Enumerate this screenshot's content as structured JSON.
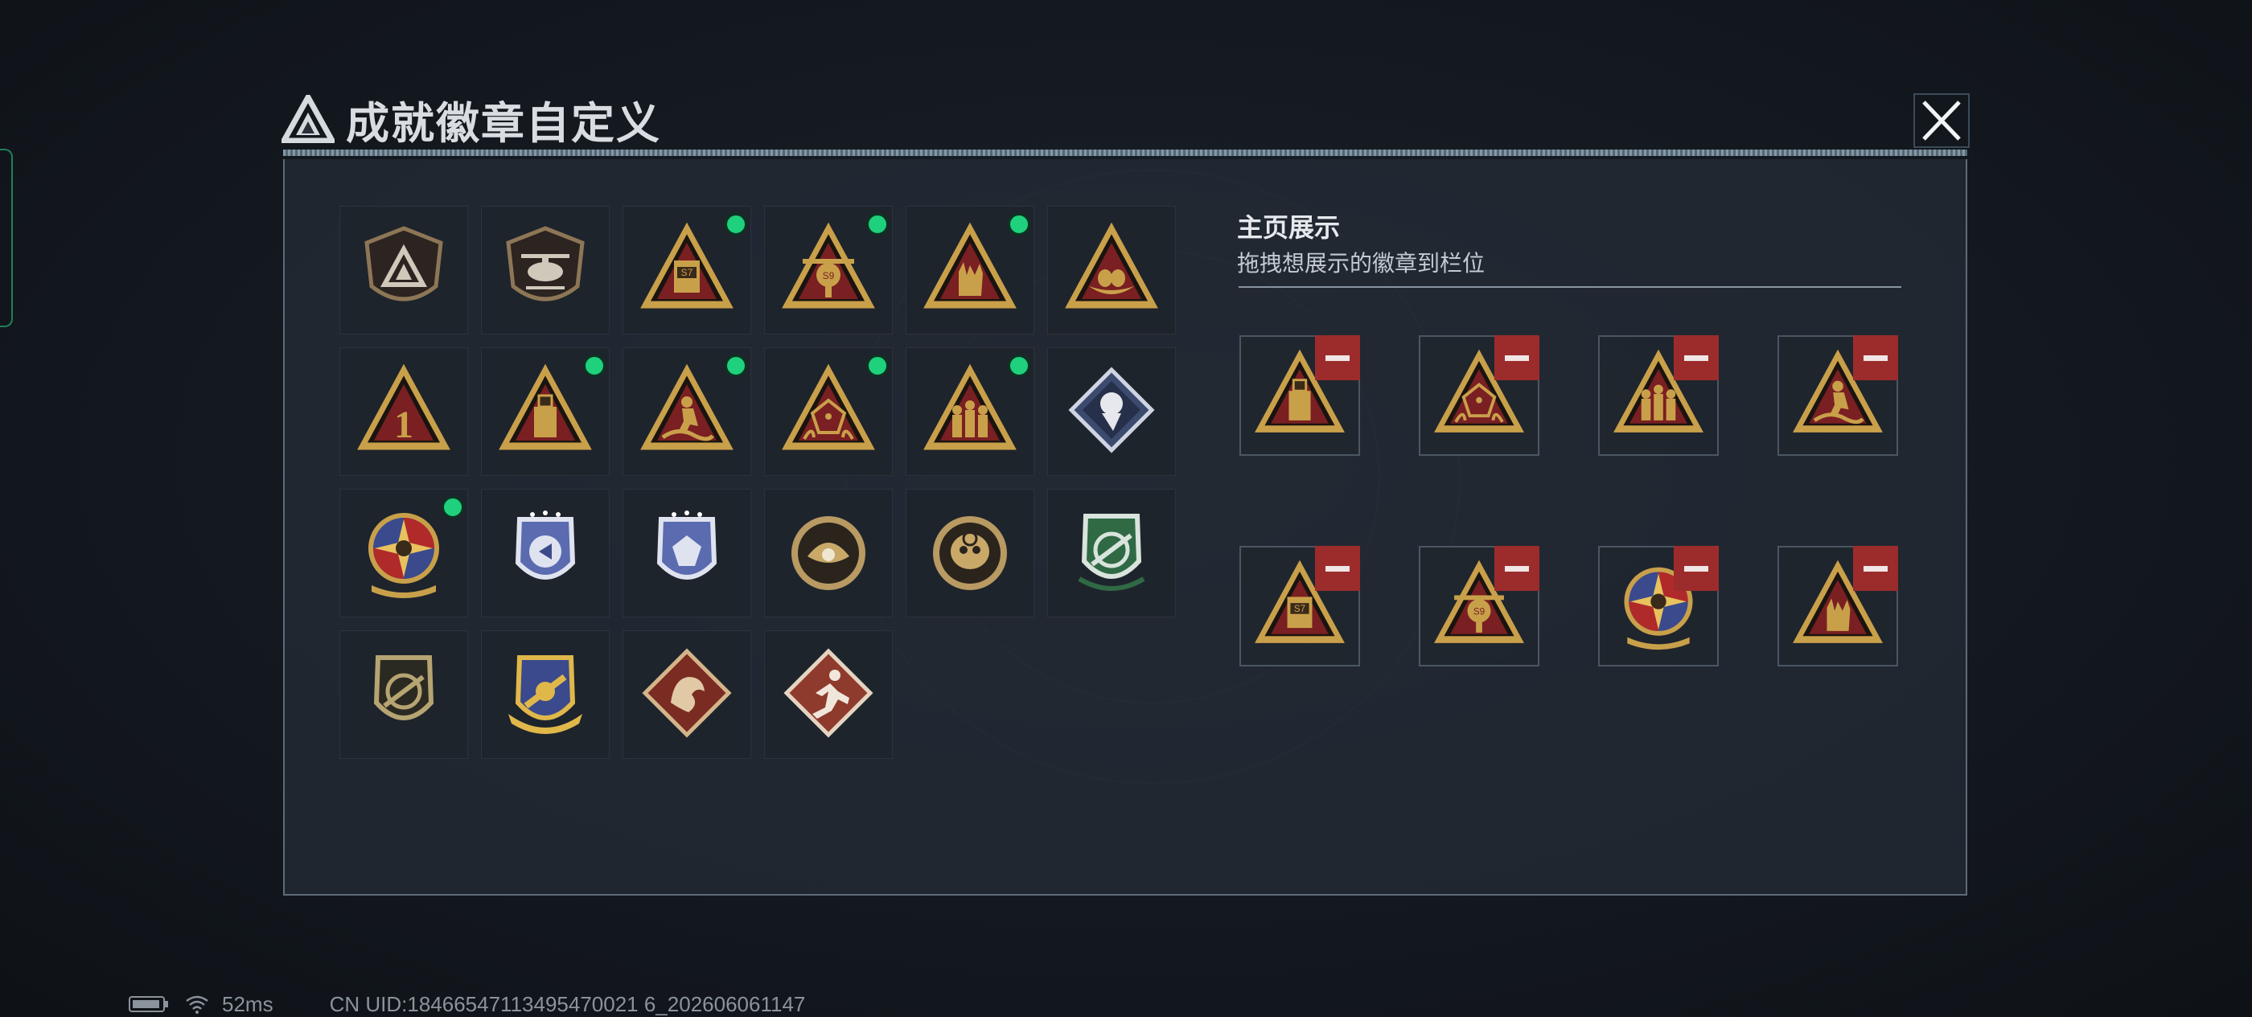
{
  "dialog": {
    "title": "成就徽章自定义",
    "close_icon": "close-icon"
  },
  "badges": [
    {
      "icon": "shield-logo-badge",
      "equipped": false
    },
    {
      "icon": "helicopter-shield-badge",
      "equipped": false
    },
    {
      "icon": "s7-triangle-badge",
      "equipped": true
    },
    {
      "icon": "s9-triangle-badge",
      "equipped": true
    },
    {
      "icon": "hand-gesture-triangle-badge",
      "equipped": true
    },
    {
      "icon": "egg-nest-triangle-badge",
      "equipped": false
    },
    {
      "icon": "number-one-triangle-badge",
      "equipped": false
    },
    {
      "icon": "usb-drive-triangle-badge",
      "equipped": true
    },
    {
      "icon": "surfer-triangle-badge",
      "equipped": true
    },
    {
      "icon": "dice-triangle-badge",
      "equipped": true
    },
    {
      "icon": "soldiers-triangle-badge",
      "equipped": true
    },
    {
      "icon": "rose-diamond-badge",
      "equipped": false
    },
    {
      "icon": "compass-star-medal-badge",
      "equipped": true
    },
    {
      "icon": "blue-winged-shield-badge",
      "equipped": false
    },
    {
      "icon": "blue-gem-shield-badge",
      "equipped": false
    },
    {
      "icon": "pearl-clam-badge",
      "equipped": false
    },
    {
      "icon": "skull-crosshair-badge",
      "equipped": false
    },
    {
      "icon": "green-rifle-target-badge",
      "equipped": false
    },
    {
      "icon": "rifle-target-badge",
      "equipped": false
    },
    {
      "icon": "gold-wings-emblem-badge",
      "equipped": false
    },
    {
      "icon": "dragon-diamond-badge",
      "equipped": false
    },
    {
      "icon": "sprinter-diamond-badge",
      "equipped": false
    }
  ],
  "showcase": {
    "heading": "主页展示",
    "subtitle": "拖拽想展示的徽章到栏位",
    "slots": [
      {
        "icon": "usb-drive-triangle-badge"
      },
      {
        "icon": "dice-triangle-badge"
      },
      {
        "icon": "soldiers-triangle-badge"
      },
      {
        "icon": "surfer-triangle-badge"
      },
      {
        "icon": "s7-triangle-badge"
      },
      {
        "icon": "s9-triangle-badge"
      },
      {
        "icon": "compass-star-medal-badge"
      },
      {
        "icon": "hand-gesture-triangle-badge"
      }
    ],
    "remove_icon": "minus-icon"
  },
  "status": {
    "battery_icon": "battery-icon",
    "wifi_icon": "wifi-icon",
    "ping": "52ms",
    "uid": "CN UID:18466547113495470021 6_202606061147"
  },
  "colors": {
    "equipped_dot": "#1fd07c",
    "remove_button": "#9c2c2c",
    "badge_gold": "#c9a04a",
    "badge_red": "#7a1f22"
  }
}
